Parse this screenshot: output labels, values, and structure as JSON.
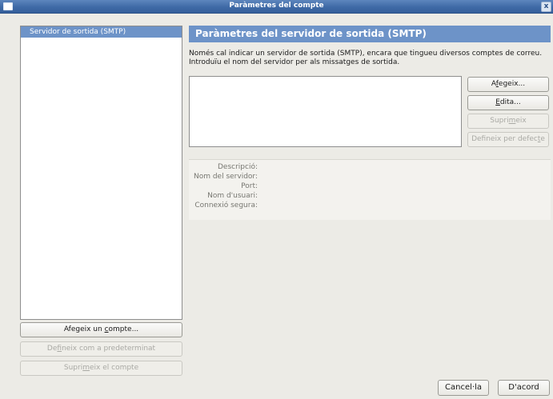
{
  "window": {
    "title": "Paràmetres del compte",
    "close_glyph": "x"
  },
  "sidebar": {
    "items": [
      {
        "label": "Servidor de sortida (SMTP)",
        "selected": true
      }
    ],
    "buttons": {
      "add_account": {
        "pre": "Afegeix un ",
        "u": "c",
        "post": "ompte..."
      },
      "set_default": {
        "pre": "De",
        "u": "f",
        "post": "ineix com a predeterminat"
      },
      "remove_account": {
        "pre": "Supri",
        "u": "m",
        "post": "eix el compte"
      }
    }
  },
  "main": {
    "header": "Paràmetres del servidor de sortida (SMTP)",
    "description_line1": "Només cal indicar un servidor de sortida (SMTP), encara que tingueu diversos comptes de correu.",
    "description_line2": "Introduïu el nom del servidor per als missatges de sortida.",
    "buttons": {
      "add": {
        "pre": "A",
        "u": "f",
        "post": "egeix..."
      },
      "edit": {
        "pre": "",
        "u": "E",
        "post": "dita..."
      },
      "delete": {
        "pre": "Supri",
        "u": "m",
        "post": "eix"
      },
      "set_default": {
        "pre": "Defineix per defec",
        "u": "t",
        "post": "e"
      }
    },
    "details": {
      "description": "Descripció:",
      "server_name": "Nom del servidor:",
      "port": "Port:",
      "username": "Nom d'usuari:",
      "secure_connection": "Connexió segura:"
    }
  },
  "footer": {
    "cancel": "Cancel·la",
    "ok": "D'acord"
  },
  "colors": {
    "titlebar": "#4a76b2",
    "selection": "#6d93c8",
    "background": "#ecebe6"
  }
}
